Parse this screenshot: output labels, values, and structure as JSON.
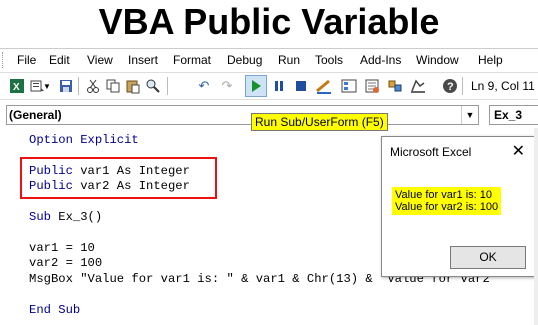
{
  "title": "VBA Public Variable",
  "menu": [
    "File",
    "Edit",
    "View",
    "Insert",
    "Format",
    "Debug",
    "Run",
    "Tools",
    "Add-Ins",
    "Window",
    "Help"
  ],
  "toolbar": {
    "icons": [
      "excel-icon",
      "insert-module-icon",
      "save-icon",
      "cut-icon",
      "copy-icon",
      "paste-icon",
      "find-icon",
      "undo-icon",
      "redo-icon",
      "run-icon",
      "break-icon",
      "reset-icon",
      "design-mode-icon",
      "project-explorer-icon",
      "properties-icon",
      "object-browser-icon",
      "toolbox-icon",
      "help-icon"
    ],
    "position": "Ln 9, Col 11"
  },
  "combos": {
    "object": "(General)",
    "procedure": "Ex_3"
  },
  "tooltip": "Run Sub/UserForm (F5)",
  "code": [
    {
      "kw": "Option Explicit",
      "rest": ""
    },
    {
      "kw": "Public",
      "rest": " var1 As Integer"
    },
    {
      "kw": "Public",
      "rest": " var2 As Integer"
    },
    {
      "kw": "Sub",
      "rest": " Ex_3()"
    },
    {
      "kw": "",
      "rest": "var1 = 10"
    },
    {
      "kw": "",
      "rest": "var2 = 100"
    },
    {
      "kw": "",
      "rest": "MsgBox \"Value for var1 is: \" & var1 & Chr(13) & \"Value for var2"
    },
    {
      "kw": "End Sub",
      "rest": ""
    }
  ],
  "dialog": {
    "title": "Microsoft Excel",
    "line1": "Value for var1 is: 10",
    "line2": "Value for var2 is: 100",
    "ok": "OK"
  }
}
